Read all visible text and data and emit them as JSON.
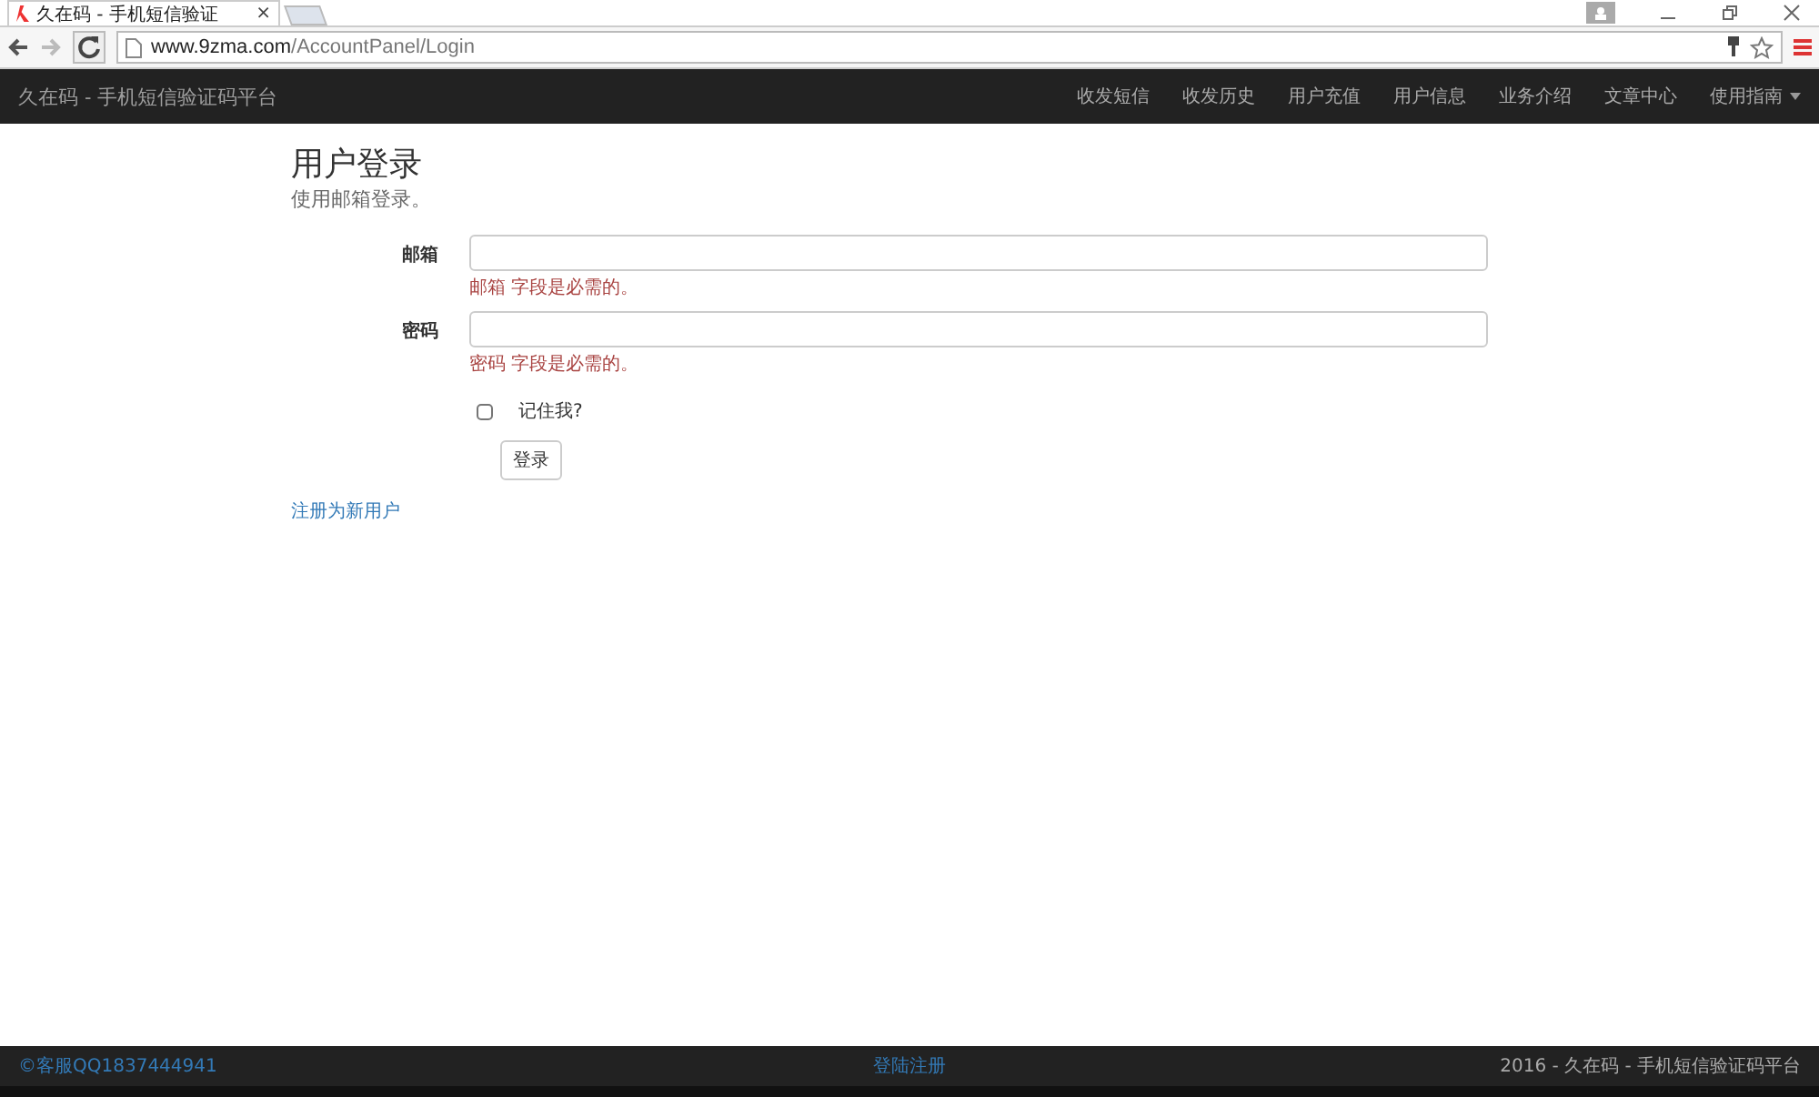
{
  "browser": {
    "tab_title": "久在码 - 手机短信验证",
    "tab_close": "×",
    "url_host": "www.9zma.com",
    "url_path": "/AccountPanel/Login"
  },
  "navbar": {
    "brand": "久在码 - 手机短信验证码平台",
    "items": [
      {
        "label": "收发短信",
        "dropdown": false
      },
      {
        "label": "收发历史",
        "dropdown": false
      },
      {
        "label": "用户充值",
        "dropdown": false
      },
      {
        "label": "用户信息",
        "dropdown": false
      },
      {
        "label": "业务介绍",
        "dropdown": false
      },
      {
        "label": "文章中心",
        "dropdown": false
      },
      {
        "label": "使用指南",
        "dropdown": true
      }
    ]
  },
  "page": {
    "title": "用户登录",
    "subtitle": "使用邮箱登录。",
    "fields": [
      {
        "label": "邮箱",
        "error": "邮箱 字段是必需的。"
      },
      {
        "label": "密码",
        "error": "密码 字段是必需的。"
      }
    ],
    "remember": {
      "label": "记住我?",
      "checked": false
    },
    "submit": "登录",
    "register_link": "注册为新用户"
  },
  "footer": {
    "left": "©客服QQ1837444941",
    "center": "登陆注册",
    "right": "2016 - 久在码 - 手机短信验证码平台"
  }
}
